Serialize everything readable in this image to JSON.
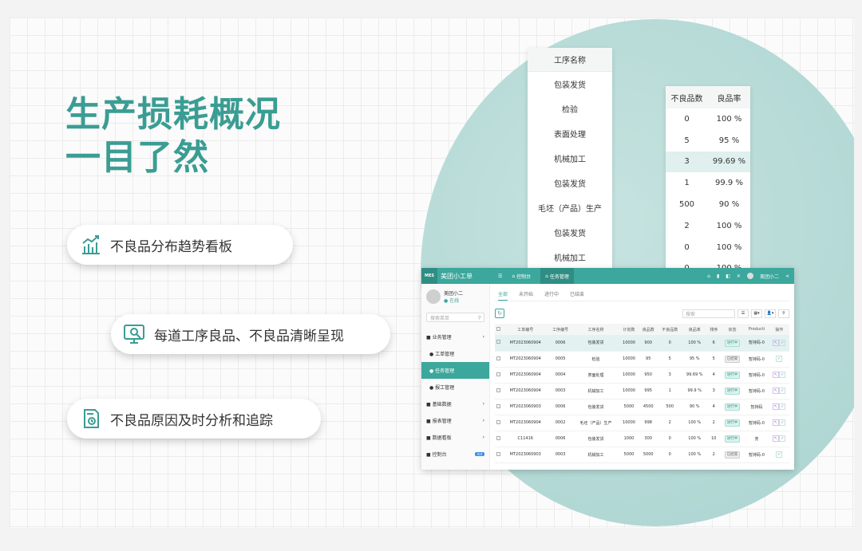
{
  "headline": {
    "line1": "生产损耗概况",
    "line2": "一目了然"
  },
  "features": [
    {
      "icon": "bar-chart-icon",
      "label": "不良品分布趋势看板"
    },
    {
      "icon": "monitor-inspect-icon",
      "label": "每道工序良品、不良品清晰呈现"
    },
    {
      "icon": "document-analysis-icon",
      "label": "不良品原因及时分析和追踪"
    }
  ],
  "process_table": {
    "header": "工序名称",
    "rows": [
      "包装发货",
      "检验",
      "表面处理",
      "机械加工",
      "包装发货",
      "毛坯（产品）生产",
      "包装发货",
      "机械加工"
    ]
  },
  "defect_table": {
    "headers": [
      "不良品数",
      "良品率"
    ],
    "rows": [
      [
        "0",
        "100 %"
      ],
      [
        "5",
        "95 %"
      ],
      [
        "3",
        "99.69 %"
      ],
      [
        "1",
        "99.9 %"
      ],
      [
        "500",
        "90 %"
      ],
      [
        "2",
        "100 %"
      ],
      [
        "0",
        "100 %"
      ],
      [
        "0",
        "100 %"
      ]
    ],
    "highlight_row": 2
  },
  "app": {
    "logo": "MES",
    "name": "美团小工单",
    "top_tabs": [
      "控制台",
      "任务管理"
    ],
    "user": {
      "name": "美团小二",
      "status": "在线"
    },
    "search_placeholder": "搜索菜单",
    "nav": [
      {
        "label": "业务管理",
        "sub": false,
        "active": false
      },
      {
        "label": "工单管理",
        "sub": true,
        "active": false
      },
      {
        "label": "任务管理",
        "sub": true,
        "active": true
      },
      {
        "label": "报工管理",
        "sub": true,
        "active": false
      },
      {
        "label": "基础数据",
        "sub": false,
        "active": false
      },
      {
        "label": "报表管理",
        "sub": false,
        "active": false
      },
      {
        "label": "数据看板",
        "sub": false,
        "active": false
      },
      {
        "label": "控制台",
        "sub": false,
        "active": false,
        "badge": "Ind"
      }
    ],
    "sub_tabs": [
      "全部",
      "未开始",
      "进行中",
      "已结束"
    ],
    "table_search": "搜索",
    "columns": [
      "工单编号",
      "工序编号",
      "工序名称",
      "计划数",
      "良品数",
      "不良品数",
      "良品率",
      "排序",
      "状态",
      "Producti",
      "操作"
    ],
    "rows": [
      [
        "MT2023060904",
        "0006",
        "包装发货",
        "10000",
        "900",
        "0",
        "100 %",
        "6",
        "进行中",
        "暂持码-0"
      ],
      [
        "MT2023060904",
        "0005",
        "检验",
        "10000",
        "95",
        "5",
        "95 %",
        "5",
        "已结束",
        "暂持码-0"
      ],
      [
        "MT2023060904",
        "0004",
        "表面处理",
        "10000",
        "950",
        "3",
        "99.69 %",
        "4",
        "进行中",
        "暂持码-0"
      ],
      [
        "MT2023060904",
        "0003",
        "机械加工",
        "10000",
        "995",
        "1",
        "99.9 %",
        "3",
        "进行中",
        "暂持码-0"
      ],
      [
        "MT2023060903",
        "0006",
        "包装发货",
        "5000",
        "4500",
        "500",
        "90 %",
        "4",
        "进行中",
        "暂持码"
      ],
      [
        "MT2023060904",
        "0002",
        "毛坯（产品）生产",
        "10000",
        "998",
        "2",
        "100 %",
        "2",
        "进行中",
        "暂持码-0"
      ],
      [
        "C11416",
        "0006",
        "包装发货",
        "1000",
        "300",
        "0",
        "100 %",
        "10",
        "进行中",
        "尧"
      ],
      [
        "MT2023060903",
        "0003",
        "机械加工",
        "5000",
        "5000",
        "0",
        "100 %",
        "2",
        "已结束",
        "暂持码-0"
      ]
    ]
  },
  "colors": {
    "accent": "#3ca79c",
    "headline": "#3a9d93",
    "circle": "#b4d9d5"
  }
}
